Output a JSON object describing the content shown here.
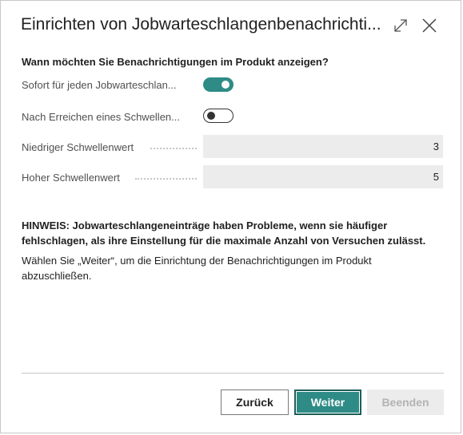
{
  "dialog": {
    "title": "Einrichten von Jobwarteschlangenbenachrichti...",
    "expand_icon": "expand-icon",
    "close_icon": "close-icon"
  },
  "section": {
    "question": "Wann möchten Sie Benachrichtigungen im Produkt anzeigen?"
  },
  "fields": {
    "immediate": {
      "label": "Sofort für jeden Jobwarteschlan...",
      "checked": true
    },
    "threshold": {
      "label": "Nach Erreichen eines Schwellen...",
      "checked": false
    },
    "low_threshold": {
      "label": "Niedriger Schwellenwert",
      "value": "3"
    },
    "high_threshold": {
      "label": "Hoher Schwellenwert",
      "value": "5"
    }
  },
  "note": {
    "warning": "HINWEIS: Jobwarteschlangeneinträge haben Probleme, wenn sie häufiger fehlschlagen, als ihre Einstellung für die maximale Anzahl von Versuchen zulässt.",
    "instruction": "Wählen Sie „Weiter“, um die Einrichtung der Benachrichtigungen im Produkt abzuschließen."
  },
  "buttons": {
    "back": "Zurück",
    "next": "Weiter",
    "finish": "Beenden"
  },
  "colors": {
    "accent": "#2f8b86",
    "field_bg": "#ececec",
    "disabled_text": "#b4b4b4"
  }
}
